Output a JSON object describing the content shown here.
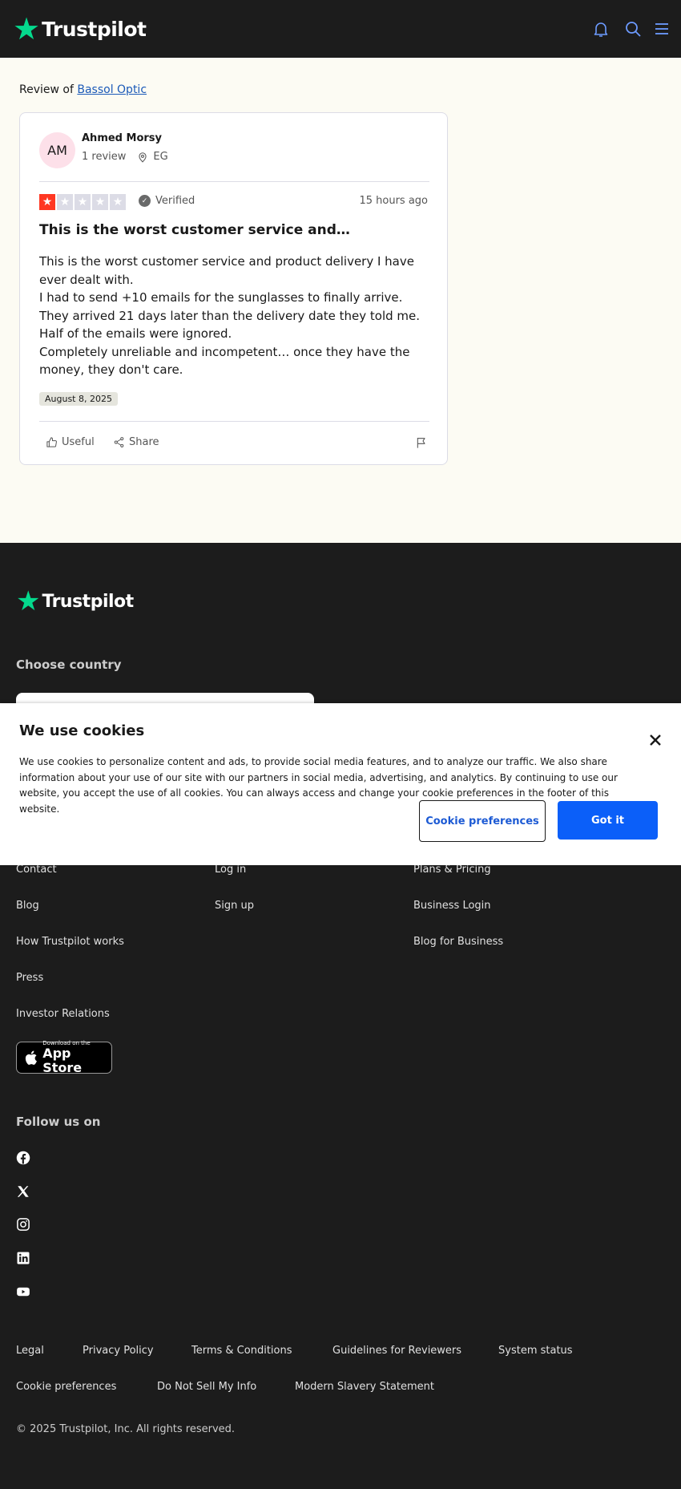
{
  "header": {
    "logo_text": "Trustpilot"
  },
  "review_of": {
    "prefix": "Review of",
    "company": "Bassol Optic"
  },
  "review": {
    "avatar_initials": "AM",
    "reviewer_name": "Ahmed Morsy",
    "review_count": "1 review",
    "country": "EG",
    "rating": 1,
    "rating_max": 5,
    "verified_label": "Verified",
    "time_ago": "15 hours ago",
    "title": "This is the worst customer service and…",
    "body_lines": [
      "This is the worst customer service and product delivery I have ever dealt with.",
      "I had to send +10 emails for the sunglasses to finally arrive. They arrived 21 days later than the delivery date they told me. Half of the emails were ignored.",
      "Completely unreliable and incompetent… once they have the money, they don't care."
    ],
    "date": "August 8, 2025",
    "useful_label": "Useful",
    "share_label": "Share"
  },
  "footer": {
    "logo_text": "Trustpilot",
    "choose_country": "Choose country",
    "col1": [
      "Contact",
      "Blog",
      "How Trustpilot works",
      "Press",
      "Investor Relations"
    ],
    "col2": [
      "Log in",
      "Sign up"
    ],
    "col3": [
      "Plans & Pricing",
      "Business Login",
      "Blog for Business"
    ],
    "appstore_small": "Download on the",
    "appstore_big": "App Store",
    "follow_us": "Follow us on",
    "legal_row1": [
      "Legal",
      "Privacy Policy",
      "Terms & Conditions",
      "Guidelines for Reviewers",
      "System status"
    ],
    "legal_row2": [
      "Cookie preferences",
      "Do Not Sell My Info",
      "Modern Slavery Statement"
    ],
    "copyright": "© 2025 Trustpilot, Inc. All rights reserved."
  },
  "cookie_banner": {
    "title": "We use cookies",
    "text": "We use cookies to personalize content and ads, to provide social media features, and to analyze our traffic. We also share information about your use of our site with our partners in social media, advertising, and analytics. By continuing to use our website, you accept the use of all cookies. You can always access and change your cookie preferences in the footer of this website.",
    "preferences_button": "Cookie preferences",
    "accept_button": "Got it"
  },
  "colors": {
    "brand_green": "#04da8d",
    "star_red": "#ff3722",
    "star_empty": "#dcdce6",
    "link_blue": "#1c5ab8",
    "button_blue": "#0b5ff9"
  }
}
